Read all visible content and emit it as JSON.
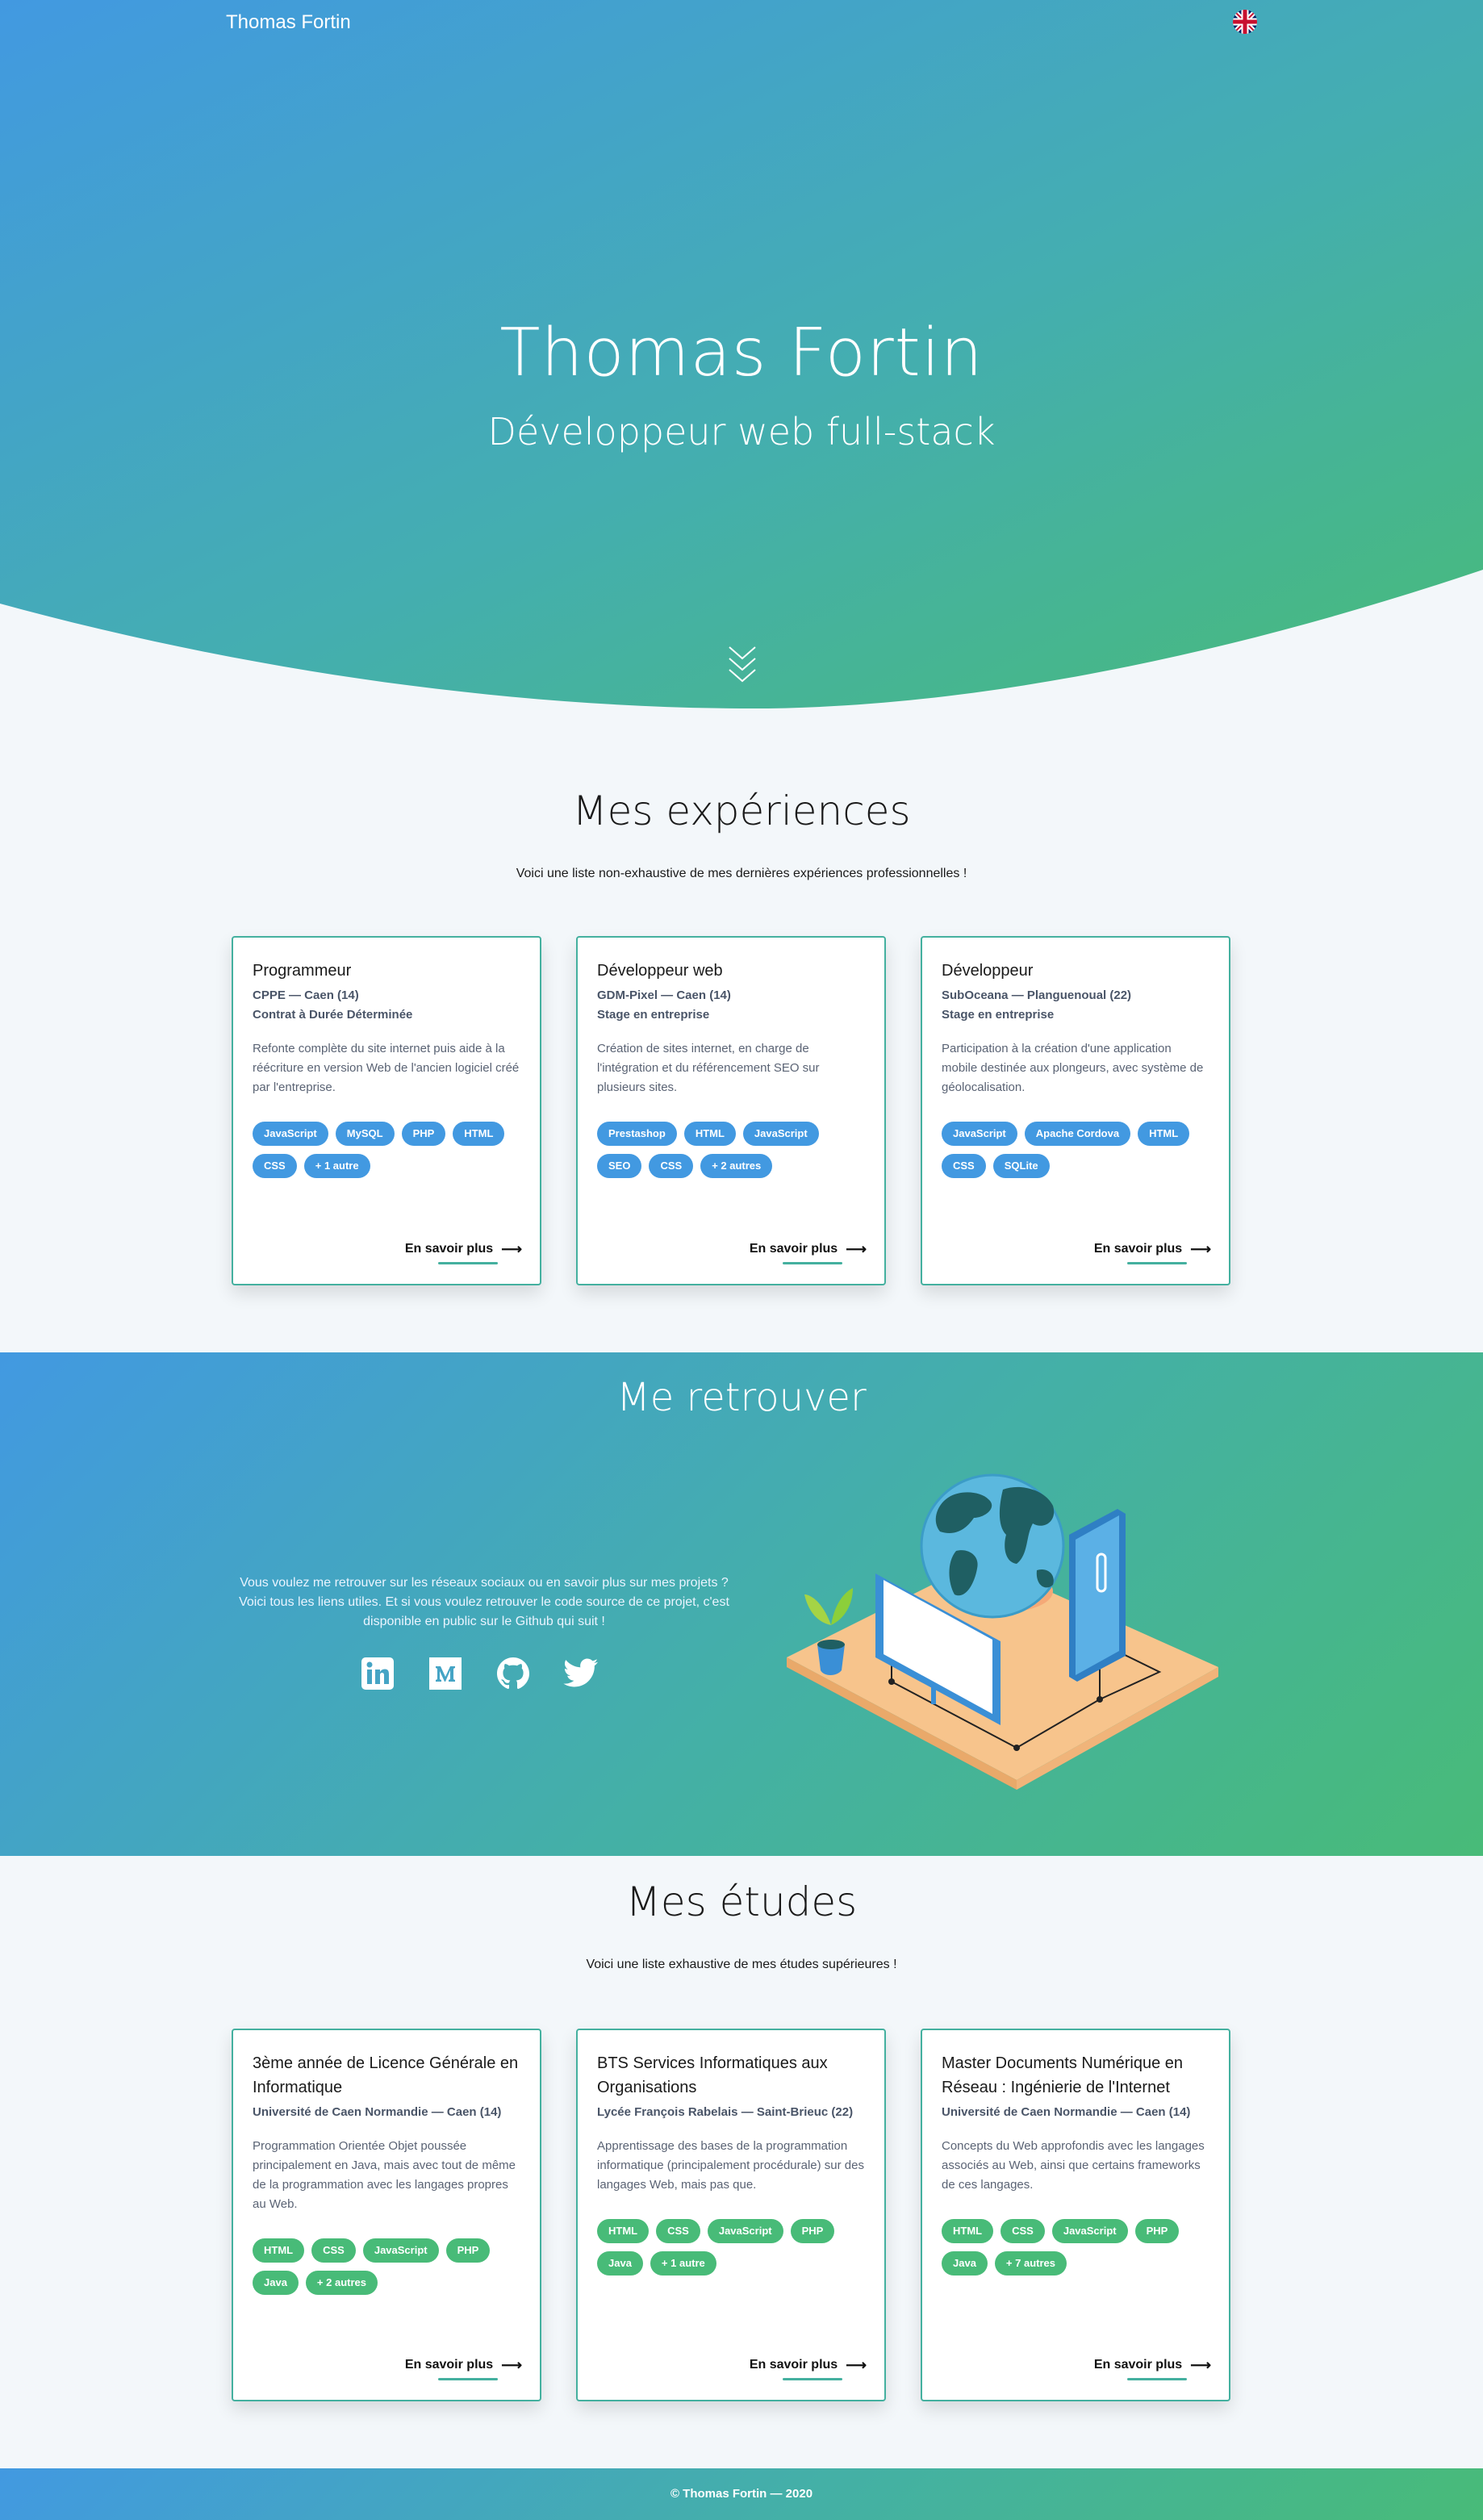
{
  "nav": {
    "brand": "Thomas Fortin",
    "language_icon": "uk-flag-icon"
  },
  "hero": {
    "title": "Thomas Fortin",
    "subtitle": "Développeur web full-stack",
    "scroll_icon": "chevrons-down-icon"
  },
  "experiences": {
    "title": "Mes expériences",
    "intro": "Voici une liste non-exhaustive de mes dernières expériences professionnelles !",
    "cards": [
      {
        "title": "Programmeur",
        "meta1": "CPPE — Caen (14)",
        "meta2": "Contrat à Durée Déterminée",
        "desc": "Refonte complète du site internet puis aide à la réécriture en version Web de l'ancien logiciel créé par l'entreprise.",
        "tags": [
          "JavaScript",
          "MySQL",
          "PHP",
          "HTML",
          "CSS",
          "+ 1 autre"
        ],
        "more": "En savoir plus"
      },
      {
        "title": "Développeur web",
        "meta1": "GDM-Pixel — Caen (14)",
        "meta2": "Stage en entreprise",
        "desc": "Création de sites internet, en charge de l'intégration et du référencement SEO sur plusieurs sites.",
        "tags": [
          "Prestashop",
          "HTML",
          "JavaScript",
          "SEO",
          "CSS",
          "+ 2 autres"
        ],
        "more": "En savoir plus"
      },
      {
        "title": "Développeur",
        "meta1": "SubOceana — Planguenoual (22)",
        "meta2": "Stage en entreprise",
        "desc": "Participation à la création d'une application mobile destinée aux plongeurs, avec système de géolocalisation.",
        "tags": [
          "JavaScript",
          "Apache Cordova",
          "HTML",
          "CSS",
          "SQLite"
        ],
        "more": "En savoir plus"
      }
    ]
  },
  "contact": {
    "title": "Me retrouver",
    "text": "Vous voulez me retrouver sur les réseaux sociaux ou en savoir plus sur mes projets ? Voici tous les liens utiles. Et si vous voulez retrouver le code source de ce projet, c'est disponible en public sur le Github qui suit !",
    "socials": [
      "linkedin-icon",
      "medium-icon",
      "github-icon",
      "twitter-icon"
    ]
  },
  "studies": {
    "title": "Mes études",
    "intro": "Voici une liste exhaustive de mes études supérieures !",
    "cards": [
      {
        "title": "3ème année de Licence Générale en Informatique",
        "meta1": "Université de Caen Normandie — Caen (14)",
        "desc": "Programmation Orientée Objet poussée principalement en Java, mais avec tout de même de la programmation avec les langages propres au Web.",
        "tags": [
          "HTML",
          "CSS",
          "JavaScript",
          "PHP",
          "Java",
          "+ 2 autres"
        ],
        "more": "En savoir plus"
      },
      {
        "title": "BTS Services Informatiques aux Organisations",
        "meta1": "Lycée François Rabelais — Saint-Brieuc (22)",
        "desc": "Apprentissage des bases de la programmation informatique (principalement procédurale) sur des langages Web, mais pas que.",
        "tags": [
          "HTML",
          "CSS",
          "JavaScript",
          "PHP",
          "Java",
          "+ 1 autre"
        ],
        "more": "En savoir plus"
      },
      {
        "title": "Master Documents Numérique en Réseau : Ingénierie de l'Internet",
        "meta1": "Université de Caen Normandie — Caen (14)",
        "desc": "Concepts du Web approfondis avec les langages associés au Web, ainsi que certains frameworks de ces langages.",
        "tags": [
          "HTML",
          "CSS",
          "JavaScript",
          "PHP",
          "Java",
          "+ 7 autres"
        ],
        "more": "En savoir plus"
      }
    ]
  },
  "footer": {
    "text": "© Thomas Fortin — 2020"
  },
  "colors": {
    "blue": "#4299e1",
    "green": "#48bb78",
    "teal": "#44b09f",
    "background": "#f3f7fa"
  }
}
